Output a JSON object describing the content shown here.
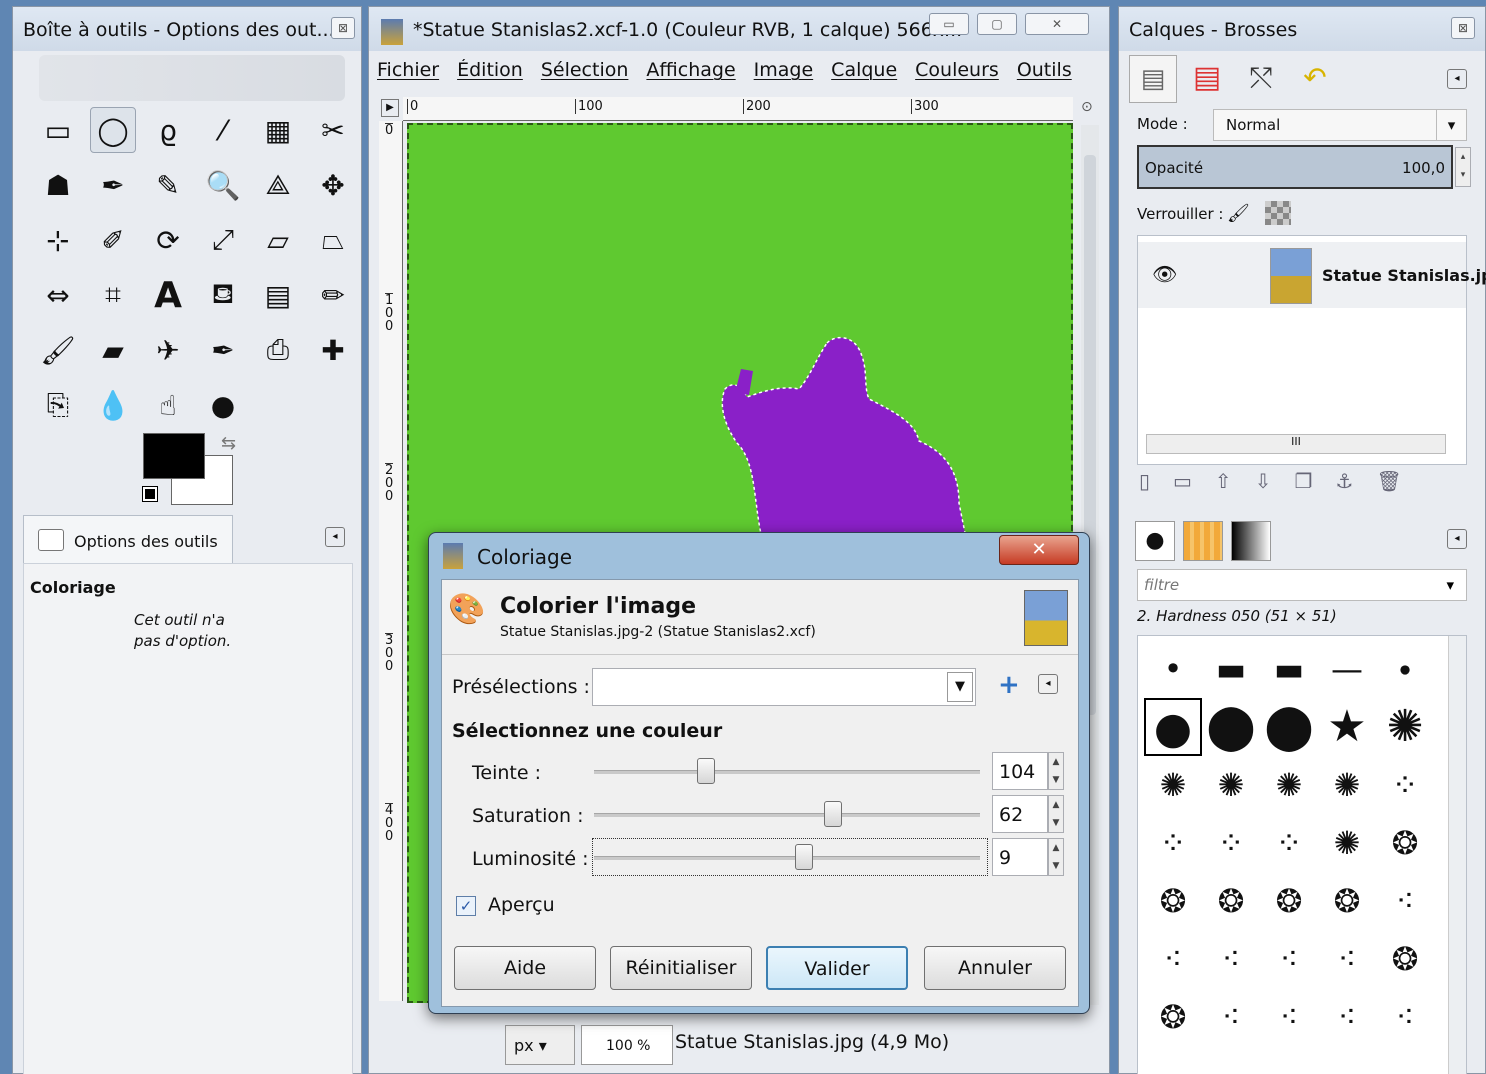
{
  "toolbox": {
    "title": "Boîte à outils - Options des out...",
    "tools": [
      "rect-select",
      "ellipse-select",
      "free-select",
      "fuzzy-select",
      "color-select",
      "scissors",
      "foreground-select",
      "paths",
      "color-picker",
      "zoom",
      "measure",
      "move",
      "align",
      "crop",
      "rotate",
      "scale",
      "shear",
      "perspective",
      "flip",
      "cage",
      "text",
      "bucket-fill",
      "blend",
      "pencil",
      "paintbrush",
      "eraser",
      "airbrush",
      "ink",
      "clone",
      "heal",
      "perspective-clone",
      "blur",
      "smudge",
      "dodge-burn"
    ],
    "options_tab": "Options des outils",
    "options_heading": "Coloriage",
    "no_options": "Cet outil n'a pas d'option."
  },
  "image_window": {
    "title": "*Statue Stanislas2.xcf-1.0 (Couleur RVB, 1 calque) 566x...",
    "menu": [
      "Fichier",
      "Édition",
      "Sélection",
      "Affichage",
      "Image",
      "Calque",
      "Couleurs",
      "Outils"
    ],
    "ruler_h": [
      "0",
      "100",
      "200",
      "300"
    ],
    "ruler_v": [
      "0",
      "100",
      "200",
      "300",
      "400"
    ],
    "unit": "px",
    "zoom": "100 %",
    "status": "Statue Stanislas.jpg (4,9 Mo)"
  },
  "dock": {
    "title": "Calques - Brosses",
    "mode_label": "Mode :",
    "mode_value": "Normal",
    "opacity_label": "Opacité",
    "opacity_value": "100,0",
    "lock_label": "Verrouiller :",
    "layer_name": "Statue Stanislas.jp",
    "brush_filter": "filtre",
    "brush_name": "2. Hardness 050 (51 × 51)"
  },
  "dialog": {
    "title": "Coloriage",
    "heading": "Colorier l'image",
    "subheading": "Statue Stanislas.jpg-2 (Statue Stanislas2.xcf)",
    "presets_label": "Présélections :",
    "section": "Sélectionnez une couleur",
    "hue": {
      "label": "Teinte :",
      "value": "104"
    },
    "saturation": {
      "label": "Saturation :",
      "value": "62"
    },
    "lightness": {
      "label": "Luminosité :",
      "value": "9"
    },
    "preview": "Aperçu",
    "buttons": {
      "help": "Aide",
      "reset": "Réinitialiser",
      "ok": "Valider",
      "cancel": "Annuler"
    }
  },
  "colors": {
    "canvas_green": "#5fc930",
    "statue_purple": "#8a20c8"
  }
}
